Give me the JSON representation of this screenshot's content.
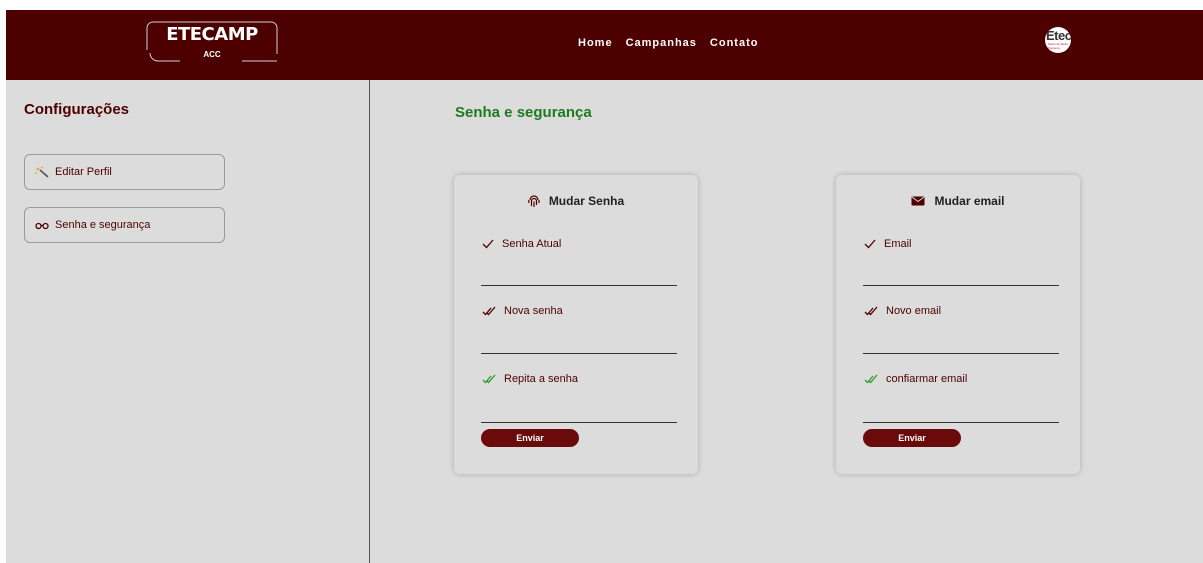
{
  "header": {
    "logo_title": "ETECAMP",
    "logo_sub": "ACC",
    "nav": [
      "Home",
      "Campanhas",
      "Contato"
    ],
    "badge_text": "Etec",
    "badge_small": "Saulo de Mello Fonseca"
  },
  "sidebar": {
    "title": "Configurações",
    "items": [
      {
        "label": "Editar Perfil",
        "icon": "magic-wand-icon"
      },
      {
        "label": "Senha e segurança",
        "icon": "glasses-icon"
      }
    ]
  },
  "main": {
    "title": "Senha e segurança",
    "cards": [
      {
        "title": "Mudar Senha",
        "icon": "fingerprint-icon",
        "fields": [
          "Senha Atual",
          "Nova senha",
          "Repita a senha"
        ],
        "button": "Enviar"
      },
      {
        "title": "Mudar email",
        "icon": "envelope-icon",
        "fields": [
          "Email",
          "Novo email",
          "confiarmar email"
        ],
        "button": "Enviar"
      }
    ]
  },
  "colors": {
    "brand": "#4d0000",
    "accent_green": "#1f7a1f",
    "button": "#6b0a0a",
    "background": "#dcdcdc"
  }
}
